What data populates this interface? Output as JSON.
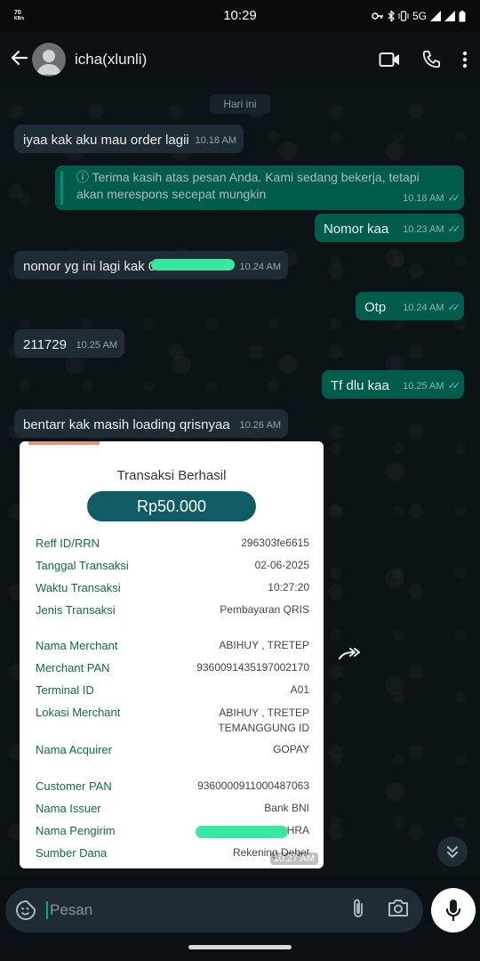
{
  "status_bar": {
    "speed_value": "70",
    "speed_unit": "KB/s",
    "time": "10:29",
    "network": "5G"
  },
  "header": {
    "contact_name": "icha(xlunli)",
    "icons": [
      "back-arrow-icon",
      "video-call-icon",
      "phone-icon",
      "more-options-icon"
    ]
  },
  "chat": {
    "date_label": "Hari ini",
    "messages": [
      {
        "side": "in",
        "text": "iyaa kak aku mau order lagii",
        "time": "10.18 AM"
      },
      {
        "side": "out",
        "text": "ⓘ Terima kasih atas pesan Anda. Kami sedang bekerja, tetapi akan merespons secepat mungkin",
        "time": "10.18 AM",
        "read": true
      },
      {
        "side": "out",
        "text": "Nomor kaa",
        "time": "10.23 AM",
        "read": true
      },
      {
        "side": "in",
        "text": "nomor yg ini lagi kak 08",
        "time": "10.24 AM"
      },
      {
        "side": "out",
        "text": "Otp",
        "time": "10.24 AM",
        "read": true
      },
      {
        "side": "in",
        "text": "211729",
        "time": "10.25 AM"
      },
      {
        "side": "out",
        "text": "Tf dlu kaa",
        "time": "10.25 AM",
        "read": true
      },
      {
        "side": "in",
        "text": "bentarr kak masih loading qrisnyaa",
        "time": "10.26 AM"
      }
    ]
  },
  "receipt": {
    "title": "Transaksi Berhasil",
    "amount": "Rp50.000",
    "rows": [
      {
        "label": "Reff ID/RRN",
        "value": "296303fe6615"
      },
      {
        "label": "Tanggal Transaksi",
        "value": "02-06-2025"
      },
      {
        "label": "Waktu Transaksi",
        "value": "10:27:20"
      },
      {
        "label": "Jenis Transaksi",
        "value": "Pembayaran QRIS"
      },
      {
        "label": "Nama Merchant",
        "value": "ABIHUY , TRETEP"
      },
      {
        "label": "Merchant PAN",
        "value": "9360091435197002170"
      },
      {
        "label": "Terminal ID",
        "value": "A01"
      },
      {
        "label": "Lokasi Merchant",
        "value": "ABIHUY , TRETEP",
        "value2": "TEMANGGUNG ID"
      },
      {
        "label": "Nama Acquirer",
        "value": "GOPAY"
      },
      {
        "label": "Customer PAN",
        "value": "9360000911000487063"
      },
      {
        "label": "Nama Issuer",
        "value": "Bank BNI"
      },
      {
        "label": "Nama Pengirim",
        "value": "HRA"
      },
      {
        "label": "Sumber Dana",
        "value": "Rekening Debet"
      }
    ],
    "time": "10.27 AM"
  },
  "input": {
    "placeholder": "Pesan"
  },
  "colors": {
    "incoming_bubble": "#202c33",
    "outgoing_bubble": "#005c4b",
    "accent": "#00a884",
    "read_ticks": "#53bdeb",
    "receipt_label": "#0f6b4d",
    "amount_pill": "#0f5c66"
  }
}
